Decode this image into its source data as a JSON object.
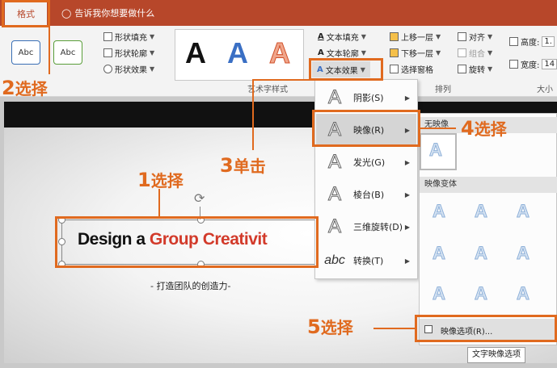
{
  "tabbar": {
    "active_tab": "格式",
    "tell_me": "告诉我你想要做什么"
  },
  "ribbon": {
    "shape_styles": {
      "swatch1": "Abc",
      "swatch2": "Abc",
      "fill": "形状填充",
      "outline": "形状轮廓",
      "effects": "形状效果"
    },
    "wordart": {
      "glyphs": [
        "A",
        "A",
        "A"
      ],
      "text_fill": "文本填充",
      "text_outline": "文本轮廓",
      "text_effects": "文本效果",
      "group_label": "艺术字样式"
    },
    "arrange": {
      "bring_forward": "上移一层",
      "send_backward": "下移一层",
      "selection_pane": "选择窗格",
      "align": "对齐",
      "group": "组合",
      "rotate": "旋转",
      "group_label": "排列"
    },
    "size": {
      "height_label": "高度:",
      "height_value": "1.",
      "width_label": "宽度:",
      "width_value": "14",
      "group_label": "大小"
    }
  },
  "slide": {
    "wordart_black": "Design a ",
    "wordart_red": "Group Creativit",
    "subtitle": "- 打造团队的创造力-"
  },
  "effects_menu": [
    {
      "label": "阴影",
      "key": "(S)"
    },
    {
      "label": "映像",
      "key": "(R)"
    },
    {
      "label": "发光",
      "key": "(G)"
    },
    {
      "label": "棱台",
      "key": "(B)"
    },
    {
      "label": "三维旋转",
      "key": "(D)"
    },
    {
      "label": "转换",
      "key": "(T)"
    }
  ],
  "reflection_panel": {
    "no_reflection": "无映像",
    "variations": "映像变体",
    "options": "映像选项(R)...",
    "tooltip": "文字映像选项"
  },
  "callouts": {
    "c1": {
      "num": "1",
      "word": "选择"
    },
    "c2": {
      "num": "2",
      "word": "选择"
    },
    "c3": {
      "num": "3",
      "word": "单击"
    },
    "c4": {
      "num": "4",
      "word": "选择"
    },
    "c5": {
      "num": "5",
      "word": "选择"
    }
  },
  "colors": {
    "brand": "#b7472a",
    "callout": "#e06a1f",
    "wordart_red": "#d23a2a"
  }
}
